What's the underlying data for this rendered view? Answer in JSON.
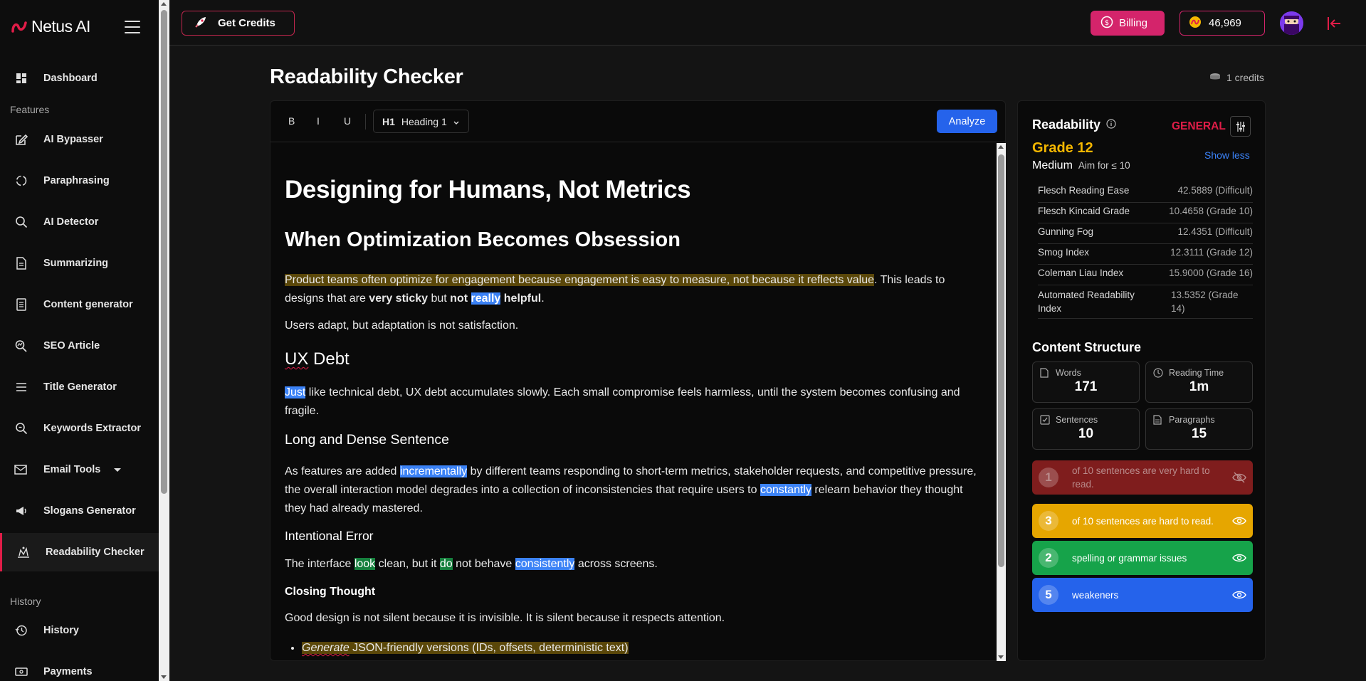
{
  "app": {
    "name": "Netus AI"
  },
  "sidebar": {
    "sections": {
      "features": "Features",
      "history": "History"
    },
    "items": [
      {
        "label": "Dashboard",
        "icon": "dashboard-icon"
      },
      {
        "label": "AI Bypasser",
        "icon": "edit-icon"
      },
      {
        "label": "Paraphrasing",
        "icon": "cycle-icon"
      },
      {
        "label": "AI Detector",
        "icon": "search-icon"
      },
      {
        "label": "Summarizing",
        "icon": "document-icon"
      },
      {
        "label": "Content generator",
        "icon": "list-document-icon"
      },
      {
        "label": "SEO Article",
        "icon": "seo-search-icon"
      },
      {
        "label": "Title Generator",
        "icon": "lines-icon"
      },
      {
        "label": "Keywords Extractor",
        "icon": "key-search-icon"
      },
      {
        "label": "Email Tools",
        "icon": "mail-icon"
      },
      {
        "label": "Slogans Generator",
        "icon": "megaphone-icon"
      },
      {
        "label": "Readability Checker",
        "icon": "readability-icon"
      },
      {
        "label": "History",
        "icon": "history-icon"
      },
      {
        "label": "Payments",
        "icon": "payments-icon"
      }
    ]
  },
  "topbar": {
    "get_credits": "Get Credits",
    "billing": "Billing",
    "credits_balance": "46,969"
  },
  "page": {
    "title": "Readability Checker",
    "cost": "1 credits"
  },
  "toolbar": {
    "bold": "B",
    "italic": "I",
    "underline": "U",
    "heading_tag": "H1",
    "heading_label": "Heading 1",
    "analyze": "Analyze"
  },
  "document": {
    "h1": "Designing for Humans, Not Metrics",
    "h2": "When Optimization Becomes Obsession",
    "p1_hl": "Product teams often optimize for engagement because engagement is easy to measure, not because it reflects value",
    "p1_rest": ". This leads to designs that are ",
    "p1_bold1": "very sticky",
    "p1_mid": " but ",
    "p1_bold2": "not",
    "p1_blue": "really",
    "p1_bold3": "helpful",
    "p1_end": ".",
    "p2": "Users adapt, but adaptation is not satisfaction.",
    "h3": "UX Debt",
    "p3_blue": "Just",
    "p3_rest": " like technical debt, UX debt accumulates slowly. Each small compromise feels harmless, until the system becomes confusing and fragile.",
    "h4": "Long and Dense Sentence",
    "p4_a": "As features are added ",
    "p4_blue1": "incrementally",
    "p4_b": " by different teams responding to short-term metrics, stakeholder requests, and competitive pressure, the overall interaction model degrades into a collection of inconsistencies that require users to ",
    "p4_blue2": "constantly",
    "p4_c": " relearn behavior they thought they had already mastered.",
    "h5": "Intentional Error",
    "p5_a": "The interface ",
    "p5_green1": "look",
    "p5_b": " clean, but it ",
    "p5_green2": "do",
    "p5_c": " not behave ",
    "p5_blue": "consistently",
    "p5_d": " across screens.",
    "h6": "Closing Thought",
    "p6": "Good design is not silent because it is invisible. It is silent because it respects attention.",
    "li1_italic": "Generate",
    "li1_rest": " JSON-friendly versions (IDs, offsets, deterministic text)"
  },
  "readability": {
    "title": "Readability",
    "mode": "GENERAL",
    "grade": "Grade 12",
    "level": "Medium",
    "aim": "Aim for ≤ 10",
    "show_less": "Show less",
    "metrics": [
      {
        "name": "Flesch Reading Ease",
        "value": "42.5889 (Difficult)"
      },
      {
        "name": "Flesch Kincaid Grade",
        "value": "10.4658 (Grade 10)"
      },
      {
        "name": "Gunning Fog",
        "value": "12.4351 (Difficult)"
      },
      {
        "name": "Smog Index",
        "value": "12.3111 (Grade 12)"
      },
      {
        "name": "Coleman Liau Index",
        "value": "15.9000 (Grade 16)"
      },
      {
        "name": "Automated Readability Index",
        "value": "13.5352 (Grade 14)"
      }
    ]
  },
  "content_structure": {
    "title": "Content Structure",
    "words_label": "Words",
    "words": "171",
    "reading_time_label": "Reading Time",
    "reading_time": "1m",
    "sentences_label": "Sentences",
    "sentences": "10",
    "paragraphs_label": "Paragraphs",
    "paragraphs": "15"
  },
  "issues": [
    {
      "count": "1",
      "text": "of 10 sentences are very hard to read.",
      "color": "#7f1d1d"
    },
    {
      "count": "3",
      "text": "of 10 sentences are hard to read.",
      "color": "#e6a600"
    },
    {
      "count": "2",
      "text": "spelling or grammar issues",
      "color": "#16a34a"
    },
    {
      "count": "5",
      "text": "weakeners",
      "color": "#2563eb"
    }
  ],
  "colors": {
    "accent": "#e11d48",
    "billing": "#d4246b",
    "grade": "#f5b700",
    "link": "#3b82f6"
  }
}
